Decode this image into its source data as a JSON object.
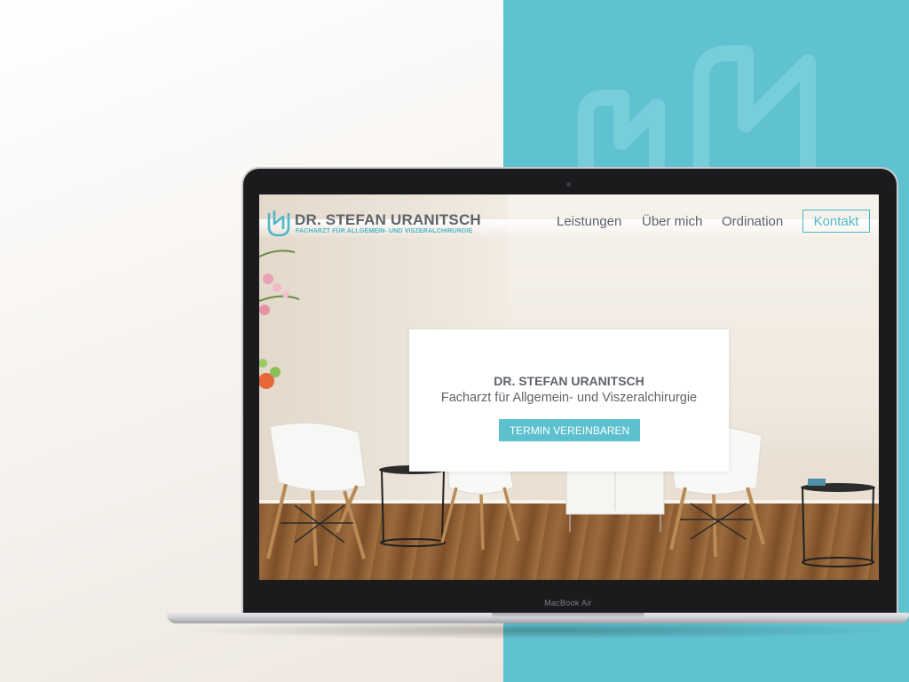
{
  "mockup": {
    "device_label": "MacBook Air",
    "background_accent": "#60c2d1"
  },
  "site": {
    "brand_name": "DR. STEFAN URANITSCH",
    "brand_tagline": "FACHARZT FÜR ALLGEMEIN- UND VISZERALCHIRURGIE",
    "logo_icon": "su-monogram-icon",
    "accent_color": "#4fb6c6",
    "text_color": "#5f6368"
  },
  "nav": {
    "items": [
      {
        "label": "Leistungen"
      },
      {
        "label": "Über mich"
      },
      {
        "label": "Ordination"
      }
    ],
    "contact_label": "Kontakt"
  },
  "hero": {
    "title": "DR. STEFAN URANITSCH",
    "subtitle": "Facharzt für Allgemein- und Viszeralchirurgie",
    "cta_label": "TERMIN VEREINBAREN"
  }
}
